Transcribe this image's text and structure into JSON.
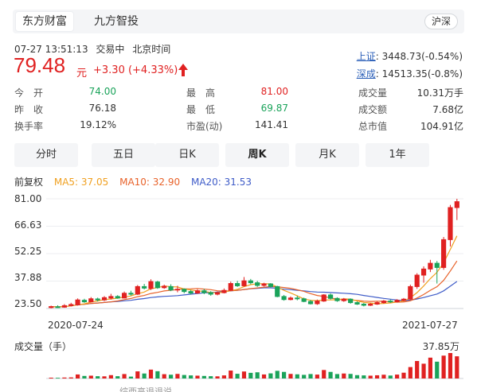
{
  "tabs": [
    {
      "label": "东方财富",
      "active": true
    },
    {
      "label": "九方智投",
      "active": false
    }
  ],
  "market_toggle": "沪深",
  "quote": {
    "datetime": "07-27 13:51:13",
    "status": "交易中",
    "timezone": "北京时间",
    "price": "79.48",
    "unit": "元",
    "change": "+3.30 (+4.33%)"
  },
  "indices": [
    {
      "name": "上证",
      "value": "3448.73(-0.54%)"
    },
    {
      "name": "深成",
      "value": "14513.35(-0.8%)"
    }
  ],
  "stats": [
    [
      {
        "label": "今　开",
        "value": "74.00",
        "color": "green"
      },
      {
        "label": "最　高",
        "value": "81.00",
        "color": "red"
      },
      {
        "label": "成交量",
        "value": "10.31万手",
        "color": ""
      }
    ],
    [
      {
        "label": "昨　收",
        "value": "76.18",
        "color": ""
      },
      {
        "label": "最　低",
        "value": "69.87",
        "color": "green"
      },
      {
        "label": "成交额",
        "value": "7.68亿",
        "color": ""
      }
    ],
    [
      {
        "label": "换手率",
        "value": "19.12%",
        "color": ""
      },
      {
        "label": "市盈(动)",
        "value": "141.41",
        "color": ""
      },
      {
        "label": "总市值",
        "value": "104.91亿",
        "color": ""
      }
    ]
  ],
  "periods": [
    {
      "label": "分时",
      "selected": false
    },
    {
      "label": "五日",
      "selected": false
    },
    {
      "label": "日K",
      "selected": false
    },
    {
      "label": "周K",
      "selected": true
    },
    {
      "label": "月K",
      "selected": false
    },
    {
      "label": "1年",
      "selected": false
    }
  ],
  "legend": {
    "adjust": "前复权",
    "ma5": "MA5: 37.05",
    "ma10": "MA10: 32.90",
    "ma20": "MA20: 31.53"
  },
  "volume": {
    "title": "成交量（手）",
    "max": "37.85万"
  },
  "footer_text": "综西高退退说",
  "colors": {
    "up": "#e02121",
    "down": "#1aa35a",
    "ma5": "#f0a020",
    "ma10": "#e8622a",
    "ma20": "#3f5cc8"
  },
  "chart_data": {
    "type": "candlestick",
    "y_ticks": [
      "81.00",
      "66.63",
      "52.25",
      "37.88",
      "23.50"
    ],
    "ylim": [
      23.5,
      81.0
    ],
    "x_labels": [
      "2020-07-24",
      "2021-07-27"
    ],
    "candles": [
      [
        24.0,
        24.5,
        23.6,
        25.0
      ],
      [
        24.4,
        24.2,
        23.8,
        25.2
      ],
      [
        24.2,
        25.0,
        23.9,
        25.8
      ],
      [
        25.0,
        25.6,
        24.6,
        26.5
      ],
      [
        25.4,
        28.0,
        25.0,
        28.8
      ],
      [
        27.8,
        27.0,
        26.5,
        28.6
      ],
      [
        27.0,
        28.6,
        26.8,
        29.5
      ],
      [
        28.5,
        28.0,
        27.2,
        29.2
      ],
      [
        28.0,
        29.2,
        27.4,
        30.0
      ],
      [
        29.0,
        29.8,
        28.2,
        31.2
      ],
      [
        29.8,
        29.0,
        28.6,
        30.5
      ],
      [
        29.0,
        31.5,
        28.8,
        32.4
      ],
      [
        31.5,
        31.0,
        30.2,
        32.8
      ],
      [
        31.0,
        35.0,
        30.6,
        35.8
      ],
      [
        35.0,
        34.2,
        33.5,
        36.4
      ],
      [
        34.0,
        37.6,
        33.2,
        38.8
      ],
      [
        37.4,
        34.4,
        33.8,
        38.0
      ],
      [
        34.4,
        35.2,
        33.8,
        36.0
      ],
      [
        35.0,
        33.2,
        32.6,
        36.2
      ],
      [
        33.2,
        33.6,
        32.0,
        35.4
      ],
      [
        33.6,
        32.4,
        31.5,
        34.0
      ],
      [
        32.4,
        31.6,
        30.8,
        33.2
      ],
      [
        31.6,
        32.8,
        31.2,
        33.6
      ],
      [
        32.8,
        31.8,
        31.0,
        33.8
      ],
      [
        31.8,
        31.0,
        30.2,
        32.6
      ],
      [
        31.0,
        31.8,
        30.4,
        32.4
      ],
      [
        31.8,
        33.0,
        31.4,
        34.0
      ],
      [
        33.0,
        36.6,
        32.6,
        37.6
      ],
      [
        36.6,
        35.4,
        34.8,
        38.0
      ],
      [
        35.4,
        38.0,
        35.0,
        40.0
      ],
      [
        38.0,
        37.0,
        36.2,
        39.0
      ],
      [
        37.0,
        35.6,
        34.8,
        38.0
      ],
      [
        35.6,
        36.4,
        35.0,
        37.0
      ],
      [
        36.4,
        35.0,
        34.6,
        36.8
      ],
      [
        35.0,
        29.8,
        29.4,
        35.4
      ],
      [
        29.8,
        28.2,
        27.6,
        30.6
      ],
      [
        28.2,
        29.0,
        27.8,
        29.8
      ],
      [
        29.0,
        28.6,
        27.8,
        30.2
      ],
      [
        28.6,
        27.2,
        26.8,
        29.2
      ],
      [
        27.2,
        26.0,
        25.6,
        28.0
      ],
      [
        26.0,
        27.4,
        25.4,
        28.2
      ],
      [
        27.4,
        30.6,
        27.0,
        31.0
      ],
      [
        30.6,
        28.8,
        28.2,
        31.4
      ],
      [
        28.8,
        27.6,
        27.0,
        29.4
      ],
      [
        27.6,
        28.4,
        27.0,
        29.0
      ],
      [
        28.4,
        26.6,
        26.0,
        28.8
      ],
      [
        26.6,
        25.8,
        25.4,
        27.2
      ],
      [
        25.8,
        25.2,
        24.6,
        26.4
      ],
      [
        25.2,
        25.8,
        24.8,
        26.4
      ],
      [
        25.8,
        26.6,
        25.4,
        27.2
      ],
      [
        26.6,
        27.4,
        26.0,
        28.0
      ],
      [
        27.4,
        27.0,
        26.4,
        28.2
      ],
      [
        27.0,
        27.8,
        26.6,
        28.4
      ],
      [
        27.8,
        28.4,
        27.2,
        29.0
      ],
      [
        28.4,
        35.0,
        28.0,
        36.0
      ],
      [
        35.0,
        41.0,
        33.8,
        42.0
      ],
      [
        41.0,
        44.2,
        37.0,
        45.6
      ],
      [
        44.2,
        47.2,
        42.6,
        49.0
      ],
      [
        47.2,
        45.0,
        36.6,
        48.4
      ],
      [
        45.0,
        59.6,
        43.8,
        61.0
      ],
      [
        59.6,
        76.4,
        56.0,
        77.8
      ],
      [
        76.4,
        79.48,
        69.87,
        81.0
      ]
    ],
    "volumes": [
      1.2,
      1.0,
      1.4,
      1.6,
      6.0,
      3.8,
      4.2,
      3.4,
      3.2,
      5.0,
      3.4,
      6.6,
      2.8,
      10.6,
      7.4,
      13.2,
      10.8,
      6.4,
      5.6,
      6.8,
      5.2,
      4.6,
      4.2,
      3.8,
      3.4,
      3.2,
      4.6,
      11.8,
      7.0,
      10.4,
      8.4,
      9.2,
      6.0,
      7.6,
      11.4,
      9.8,
      6.8,
      6.2,
      5.4,
      6.6,
      5.8,
      12.6,
      9.8,
      6.6,
      7.4,
      6.8,
      5.0,
      4.6,
      4.2,
      4.8,
      5.6,
      4.4,
      5.8,
      8.6,
      17.0,
      26.0,
      22.0,
      31.0,
      25.0,
      34.0,
      37.85,
      33.0
    ]
  }
}
